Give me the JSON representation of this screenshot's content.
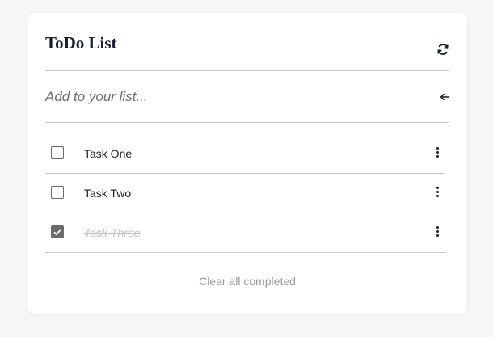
{
  "header": {
    "title": "ToDo List",
    "refresh_icon": "refresh-icon"
  },
  "add": {
    "placeholder": "Add to your list...",
    "value": "",
    "submit_icon": "arrow-left-icon"
  },
  "tasks": [
    {
      "label": "Task One",
      "completed": false,
      "menu_icon": "kebab-menu-icon"
    },
    {
      "label": "Task Two",
      "completed": false,
      "menu_icon": "kebab-menu-icon"
    },
    {
      "label": "Task Three",
      "completed": true,
      "menu_icon": "kebab-menu-icon"
    }
  ],
  "footer": {
    "clear_label": "Clear all completed"
  },
  "colors": {
    "title": "#1b1f2a",
    "divider": "#c9c9c9",
    "checkbox": "#6b6b6b",
    "completed_text": "#c3c3c3",
    "muted": "#9a9a9a"
  }
}
